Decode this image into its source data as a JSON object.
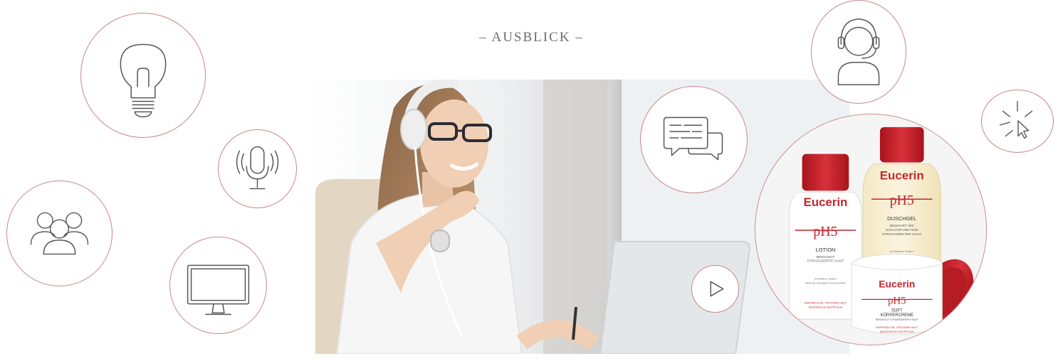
{
  "section_title": "– AUSBLICK –",
  "brand_color": "#c4262e",
  "circle_stroke_color": "#c9868a",
  "icons": [
    "lightbulb-icon",
    "microphone-icon",
    "group-icon",
    "monitor-icon",
    "chat-icon",
    "play-icon",
    "headset-agent-icon",
    "click-cursor-icon"
  ],
  "products": {
    "lotion": {
      "brand": "Eucerin",
      "line": "pH5",
      "name": "LOTION",
      "sub1": "BERUHIGT",
      "sub2": "STRAPAZIERTE HAUT",
      "note1": "pH-Balance System",
      "note2": "Stärkt die hauteigene Schutzfunktion",
      "footer1": "EMPFINDLICHE, TROCKENE HAUT",
      "footer2": "MEDIZINISCHE HAUTPFLEGE"
    },
    "shower": {
      "brand": "Eucerin",
      "line": "pH5",
      "name": "DUSCHGEL",
      "sub1": "BEWAHRT DIE",
      "sub2": "SCHUTZFUNKTION",
      "sub3": "STRAPAZIERTER HAUT",
      "note1": "pH-Balance System",
      "note2": "Reinigt die Haut extra mild",
      "note3": "ohne auszutrocknen"
    },
    "cream": {
      "brand": "Eucerin",
      "line": "pH5",
      "name1": "SOFT",
      "name2": "KÖRPERCREME",
      "sub1": "BERUHIGT STRAPAZIERTE HAUT",
      "footer1": "EMPFINDLICHE, TROCKENE HAUT",
      "footer2": "MEDIZINISCHE HAUTPFLEGE"
    }
  }
}
